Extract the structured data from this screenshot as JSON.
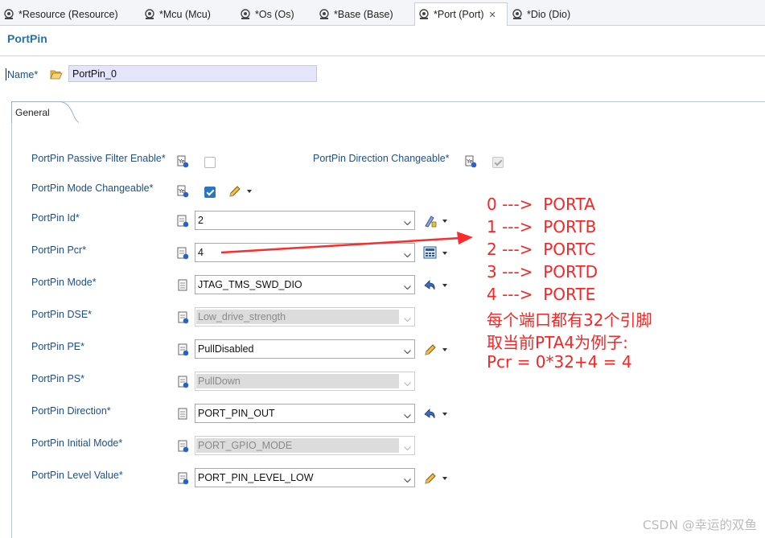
{
  "tabs": [
    {
      "label": "*Resource (Resource)",
      "active": false
    },
    {
      "label": "*Mcu (Mcu)",
      "active": false
    },
    {
      "label": "*Os (Os)",
      "active": false
    },
    {
      "label": "*Base (Base)",
      "active": false
    },
    {
      "label": "*Port (Port)",
      "active": true
    },
    {
      "label": "*Dio (Dio)",
      "active": false
    }
  ],
  "page_title": "PortPin",
  "name_field": {
    "label": "Name*",
    "value": "PortPin_0"
  },
  "general_tab": "General",
  "fields": {
    "passive_filter": {
      "label": "PortPin Passive Filter Enable*",
      "checked": false
    },
    "direction_changeable": {
      "label": "PortPin Direction Changeable*",
      "checked": true,
      "disabled": true
    },
    "mode_changeable": {
      "label": "PortPin Mode Changeable*",
      "checked": true
    },
    "id": {
      "label": "PortPin Id*",
      "value": "2"
    },
    "pcr": {
      "label": "PortPin Pcr*",
      "value": "4"
    },
    "mode": {
      "label": "PortPin Mode*",
      "value": "JTAG_TMS_SWD_DIO"
    },
    "dse": {
      "label": "PortPin DSE*",
      "value": "Low_drive_strength",
      "disabled": true
    },
    "pe": {
      "label": "PortPin PE*",
      "value": "PullDisabled"
    },
    "ps": {
      "label": "PortPin PS*",
      "value": "PullDown",
      "disabled": true
    },
    "direction": {
      "label": "PortPin Direction*",
      "value": "PORT_PIN_OUT"
    },
    "initial_mode": {
      "label": "PortPin Initial Mode*",
      "value": "PORT_GPIO_MODE",
      "disabled": true
    },
    "level_value": {
      "label": "PortPin Level Value*",
      "value": "PORT_PIN_LEVEL_LOW"
    }
  },
  "annotation": {
    "lines": [
      "0 --->  PORTA",
      "1 --->  PORTB",
      "2 --->  PORTC",
      "3 --->  PORTD",
      "4 --->  PORTE",
      "每个端口都有32个引脚",
      "取当前PTA4为例子:",
      "Pcr = 0*32+4 = 4"
    ],
    "color": "#ff2222"
  },
  "watermark": "CSDN @幸运的双鱼"
}
